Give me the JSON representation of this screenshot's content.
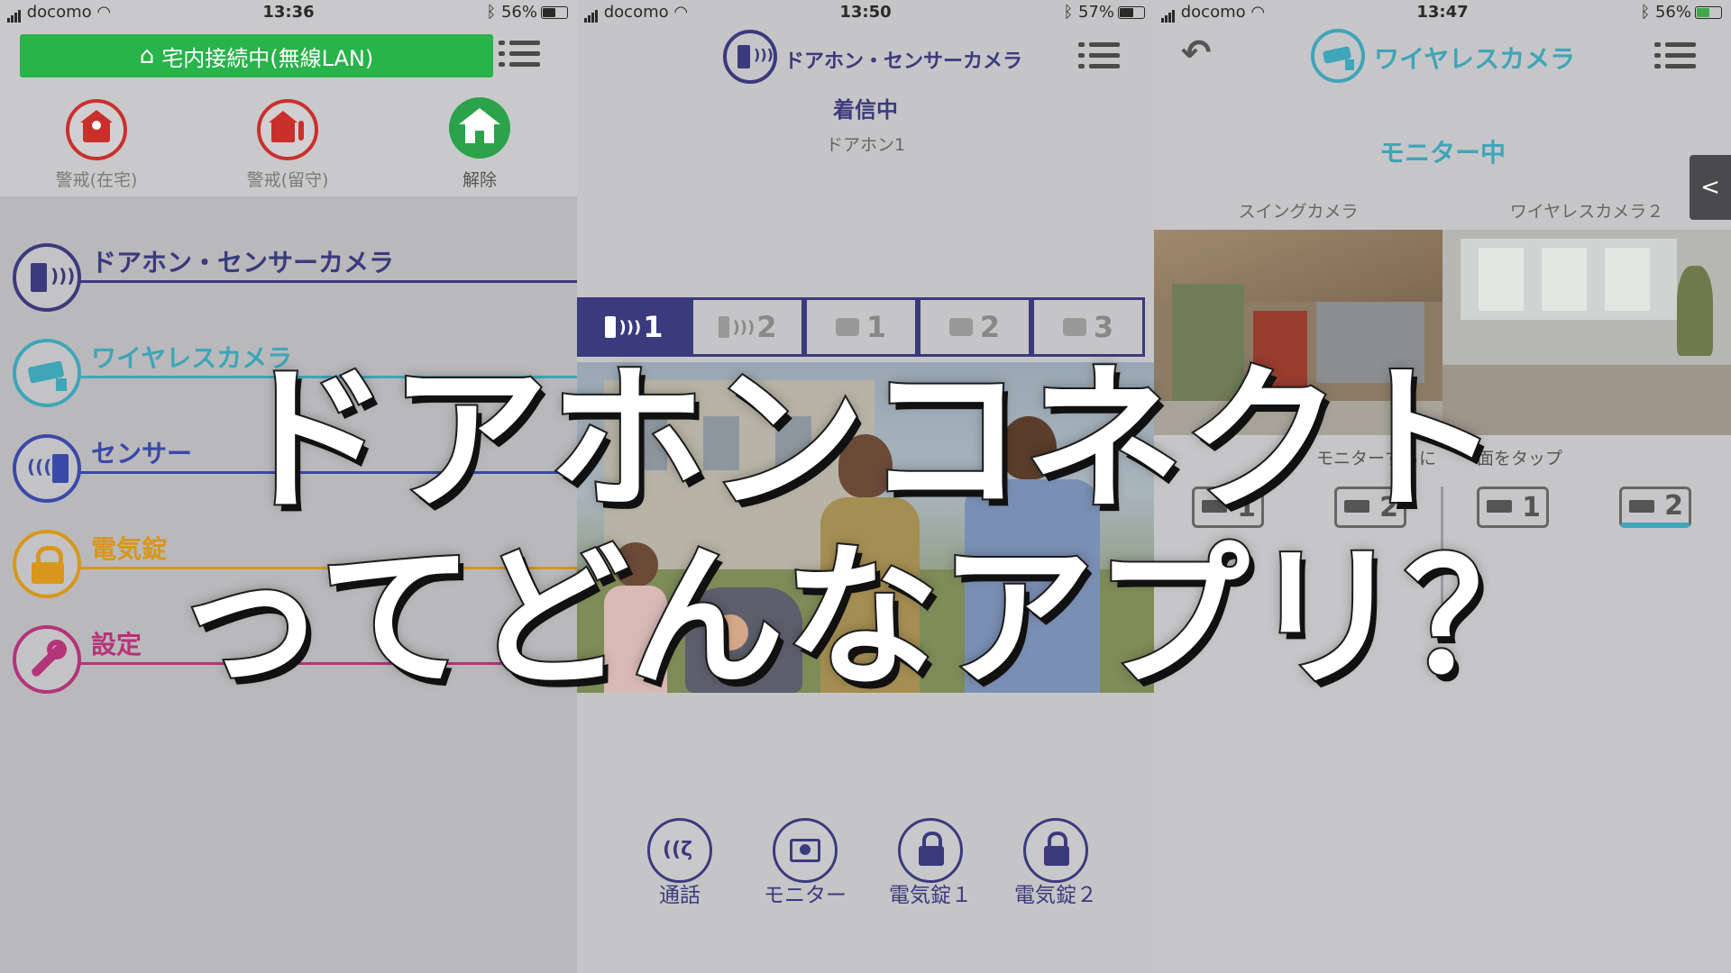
{
  "status": {
    "left": {
      "carrier": "docomo",
      "time": "13:36",
      "battery": "56%"
    },
    "middle": {
      "carrier": "docomo",
      "time": "13:50",
      "battery": "57%"
    },
    "right": {
      "carrier": "docomo",
      "time": "13:47",
      "battery": "56%"
    }
  },
  "left": {
    "connection_label": "宅内接続中(無線LAN)",
    "modes": [
      {
        "label": "警戒(在宅)",
        "icon": "home-person-icon"
      },
      {
        "label": "警戒(留守)",
        "icon": "home-leave-icon"
      },
      {
        "label": "解除",
        "icon": "home-icon"
      }
    ],
    "menu": [
      {
        "label": "ドアホン・センサーカメラ",
        "icon": "doorphone-icon",
        "color": "#3b3a7e"
      },
      {
        "label": "ワイヤレスカメラ",
        "icon": "camera-icon",
        "color": "#3fa5b8"
      },
      {
        "label": "センサー",
        "icon": "sensor-icon",
        "color": "#3b49a8"
      },
      {
        "label": "電気錠",
        "icon": "lock-icon",
        "color": "#d8961c"
      },
      {
        "label": "設定",
        "icon": "wrench-icon",
        "color": "#b4347a"
      }
    ]
  },
  "middle": {
    "header_title": "ドアホン・センサーカメラ",
    "call_status": "着信中",
    "source": "ドアホン1",
    "tabs": [
      {
        "label": "1",
        "icon": "doorphone-icon",
        "active": true
      },
      {
        "label": "2",
        "icon": "doorphone-icon",
        "active": false
      },
      {
        "label": "1",
        "icon": "sensor-camera-icon",
        "active": false
      },
      {
        "label": "2",
        "icon": "sensor-camera-icon",
        "active": false
      },
      {
        "label": "3",
        "icon": "sensor-camera-icon",
        "active": false
      }
    ],
    "actions": [
      {
        "label": "通話",
        "icon": "talk-icon"
      },
      {
        "label": "モニター",
        "icon": "monitor-icon"
      },
      {
        "label": "電気錠１",
        "icon": "lock-icon"
      },
      {
        "label": "電気錠２",
        "icon": "lock-icon"
      }
    ]
  },
  "right": {
    "header_title": "ワイヤレスカメラ",
    "monitor_status": "モニター中",
    "cameras": [
      "スイングカメラ",
      "ワイヤレスカメラ２"
    ],
    "hint_left": "モニターするに",
    "hint_right": "面をタップ",
    "side_tab": "<",
    "camera_buttons": [
      "1",
      "2",
      "1",
      "2"
    ]
  },
  "overlay": {
    "line1": "ドアホンコネクト",
    "line2": "ってどんなアプリ？"
  },
  "colors": {
    "doorphone_purple": "#3b3a7e",
    "connection_green": "#28b34b",
    "alert_red": "#c9302c",
    "release_green": "#2aa34a",
    "camera_teal": "#3fa5b8"
  }
}
